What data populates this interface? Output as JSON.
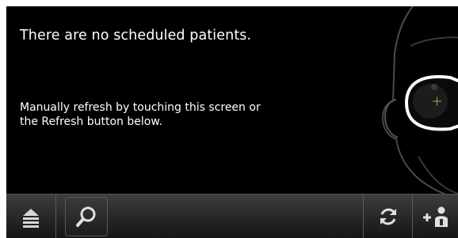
{
  "status": {
    "headline": "There are no scheduled patients.",
    "hint_lines": [
      "Manually refresh by touching this screen or",
      "the Refresh button below."
    ]
  },
  "toolbar": {
    "buttons": [
      {
        "name": "menu-button",
        "icon": "eject-menu-icon"
      },
      {
        "name": "search-button",
        "icon": "magnifier-icon"
      },
      {
        "name": "refresh-button",
        "icon": "refresh-icon"
      },
      {
        "name": "add-patient-button",
        "icon": "add-person-icon"
      }
    ]
  },
  "colors": {
    "background": "#000000",
    "text": "#ffffff",
    "toolbar": "#2a2a2a",
    "art_line": "#5a5a5a",
    "eye_marker": "#7fbf3f"
  }
}
